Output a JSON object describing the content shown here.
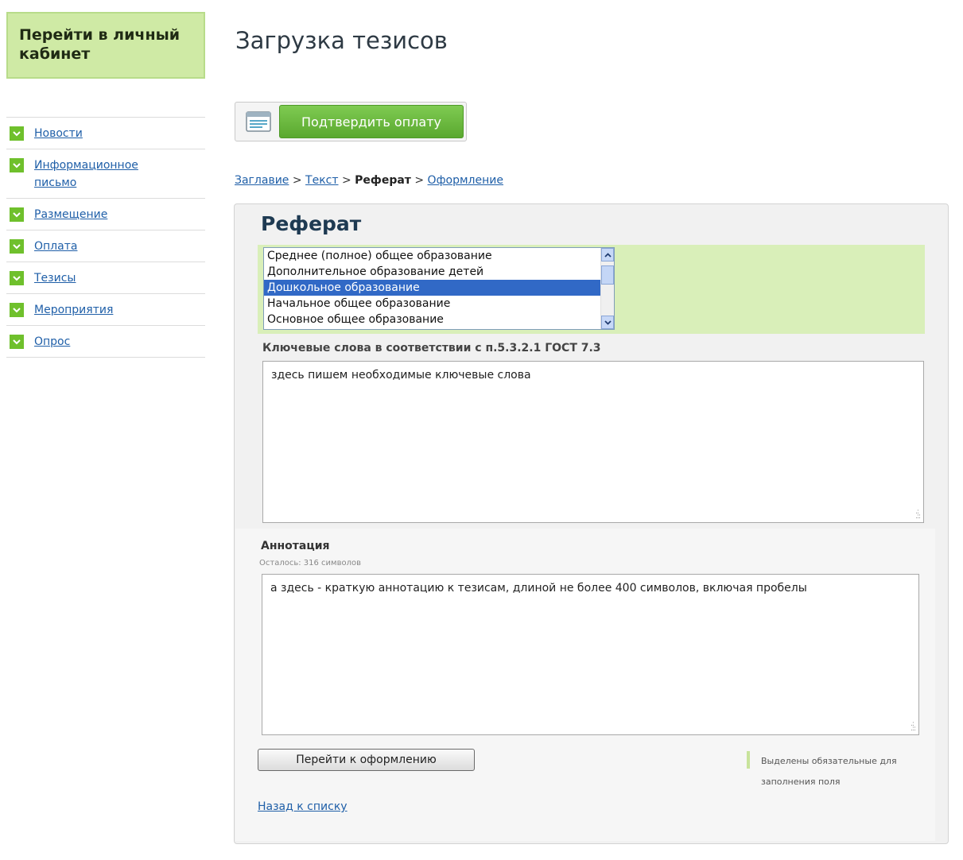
{
  "sidebar": {
    "account_link": "Перейти в личный кабинет",
    "items": [
      {
        "label": "Новости"
      },
      {
        "label": "Информационное письмо"
      },
      {
        "label": "Размещение"
      },
      {
        "label": "Оплата"
      },
      {
        "label": "Тезисы"
      },
      {
        "label": "Мероприятия"
      },
      {
        "label": "Опрос"
      }
    ]
  },
  "header": {
    "title": "Загрузка тезисов"
  },
  "payment": {
    "button_label": "Подтвердить оплату"
  },
  "breadcrumb": {
    "step1": "Заглавие",
    "step2": "Текст",
    "current": "Реферат",
    "step4": "Оформление",
    "separator": ">"
  },
  "form": {
    "title": "Реферат",
    "education_options": [
      "Среднее (полное) общее образование",
      "Дополнительное образование детей",
      "Дошкольное образование",
      "Начальное общее образование",
      "Основное общее образование"
    ],
    "selected_option": "Дошкольное образование",
    "keywords_label": "Ключевые слова в соответствии с п.5.3.2.1 ГОСТ 7.3",
    "keywords_value": "здесь пишем необходимые ключевые слова",
    "annotation_label": "Аннотация",
    "annotation_counter": "Осталось: 316 символов",
    "annotation_value": "а здесь - краткую аннотацию к тезисам, длиной не более 400 символов, включая пробелы",
    "next_button": "Перейти к оформлению",
    "required_note": "Выделены обязательные для заполнения поля",
    "back_link": "Назад к списку"
  },
  "colors": {
    "accent_green": "#6fc02c",
    "highlight_green": "#d9efb9",
    "link_blue": "#1f5fa8",
    "selection_blue": "#3169c6"
  }
}
